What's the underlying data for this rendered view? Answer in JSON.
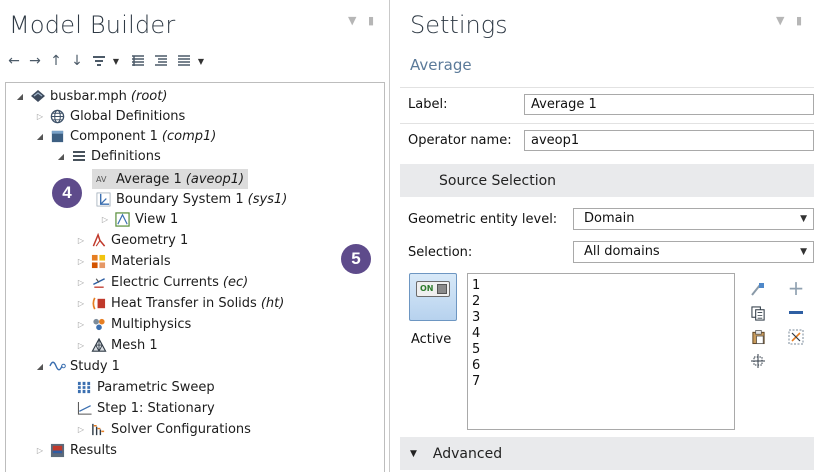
{
  "model_builder": {
    "title": "Model Builder",
    "toolbar": [
      "back",
      "forward",
      "up",
      "down",
      "show",
      "expand",
      "collapse",
      "sort"
    ],
    "tree": [
      {
        "label": "busbar.mph",
        "tag": "(root)",
        "icon": "model-icon",
        "expander": "expanded"
      },
      {
        "label": "Global Definitions",
        "tag": "",
        "icon": "globe-icon",
        "expander": "collapsed"
      },
      {
        "label": "Component 1",
        "tag": "(comp1)",
        "icon": "component-icon",
        "expander": "expanded"
      },
      {
        "label": "Definitions",
        "tag": "",
        "icon": "definitions-icon",
        "expander": "expanded"
      },
      {
        "label": "Average 1",
        "tag": "(aveop1)",
        "icon": "average-icon",
        "expander": "none",
        "selected": true
      },
      {
        "label": "Boundary System 1",
        "tag": "(sys1)",
        "icon": "coordinate-system-icon",
        "expander": "none"
      },
      {
        "label": "View 1",
        "tag": "",
        "icon": "view-icon",
        "expander": "collapsed"
      },
      {
        "label": "Geometry 1",
        "tag": "",
        "icon": "geometry-icon",
        "expander": "collapsed"
      },
      {
        "label": "Materials",
        "tag": "",
        "icon": "materials-icon",
        "expander": "collapsed"
      },
      {
        "label": "Electric Currents",
        "tag": "(ec)",
        "icon": "electric-currents-icon",
        "expander": "collapsed"
      },
      {
        "label": "Heat Transfer in Solids",
        "tag": "(ht)",
        "icon": "heat-transfer-icon",
        "expander": "collapsed"
      },
      {
        "label": "Multiphysics",
        "tag": "",
        "icon": "multiphysics-icon",
        "expander": "collapsed"
      },
      {
        "label": "Mesh 1",
        "tag": "",
        "icon": "mesh-icon",
        "expander": "collapsed"
      },
      {
        "label": "Study 1",
        "tag": "",
        "icon": "study-icon",
        "expander": "expanded"
      },
      {
        "label": "Parametric Sweep",
        "tag": "",
        "icon": "parametric-sweep-icon",
        "expander": "none"
      },
      {
        "label": "Step 1: Stationary",
        "tag": "",
        "icon": "stationary-step-icon",
        "expander": "none"
      },
      {
        "label": "Solver Configurations",
        "tag": "",
        "icon": "solver-icon",
        "expander": "collapsed"
      },
      {
        "label": "Results",
        "tag": "",
        "icon": "results-icon",
        "expander": "collapsed"
      }
    ]
  },
  "callouts": {
    "left": "4",
    "right": "5",
    "color": "#5e4b8b"
  },
  "settings": {
    "title": "Settings",
    "subtitle": "Average",
    "label_field": {
      "label": "Label:",
      "value": "Average 1"
    },
    "operator_field": {
      "label": "Operator name:",
      "value": "aveop1"
    },
    "source_section": "Source Selection",
    "entity_level": {
      "label": "Geometric entity level:",
      "value": "Domain"
    },
    "selection": {
      "label": "Selection:",
      "value": "All domains"
    },
    "active": {
      "toggle": "ON",
      "label": "Active"
    },
    "selection_items": [
      "1",
      "2",
      "3",
      "4",
      "5",
      "6",
      "7"
    ],
    "advanced_section": "Advanced"
  },
  "colors": {
    "accent": "#5b7a99",
    "section_bg": "#e9eaec",
    "selected_row": "#dcdcdc"
  }
}
